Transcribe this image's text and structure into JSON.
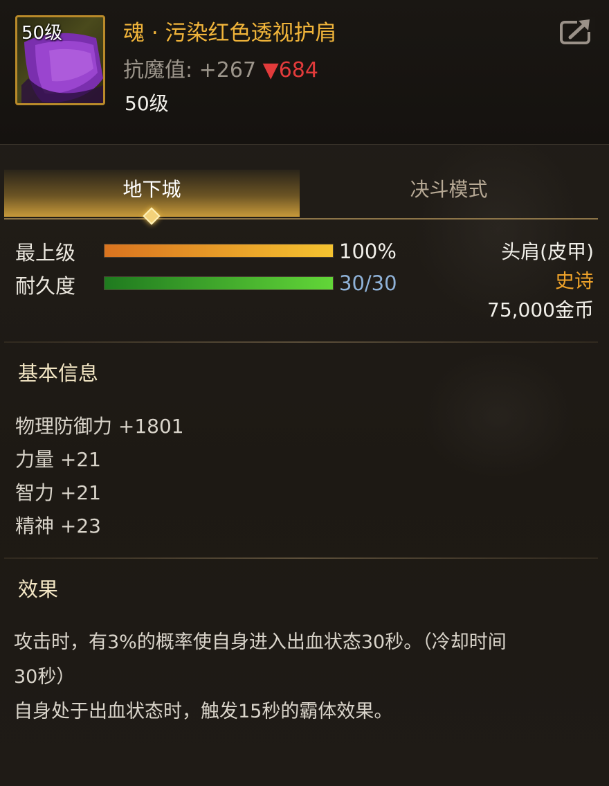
{
  "item": {
    "icon_level": "50级",
    "title": "魂 · 污染红色透视护肩",
    "resist_label": "抗魔值:",
    "resist_value": "+267",
    "resist_down_arrow": "▼",
    "resist_down_value": "684",
    "required_level": "50级",
    "share_icon": "share-icon"
  },
  "tabs": [
    {
      "label": "地下城",
      "active": true
    },
    {
      "label": "决斗模式",
      "active": false
    }
  ],
  "bars": {
    "grade": {
      "label": "最上级",
      "value_text": "100%",
      "fraction": 1.0
    },
    "durability": {
      "label": "耐久度",
      "value_text": "30/30",
      "fraction": 1.0
    }
  },
  "meta": {
    "slot_type": "头肩(皮甲)",
    "rarity": "史诗",
    "price": "75,000金币"
  },
  "basic_info": {
    "title": "基本信息",
    "lines": [
      "物理防御力 +1801",
      "力量 +21",
      "智力 +21",
      "精神 +23"
    ]
  },
  "effect": {
    "title": "效果",
    "lines": [
      "攻击时，有3%的概率使自身进入出血状态30秒。（冷却时间",
      "30秒）",
      "自身处于出血状态时，触发15秒的霸体效果。"
    ]
  },
  "colors": {
    "title": "#f0b43a",
    "rarity_epic": "#f0a32a",
    "resist_down": "#e23b3b",
    "durability_text": "#8fb2d8",
    "icon_border": "#b98a2a"
  }
}
